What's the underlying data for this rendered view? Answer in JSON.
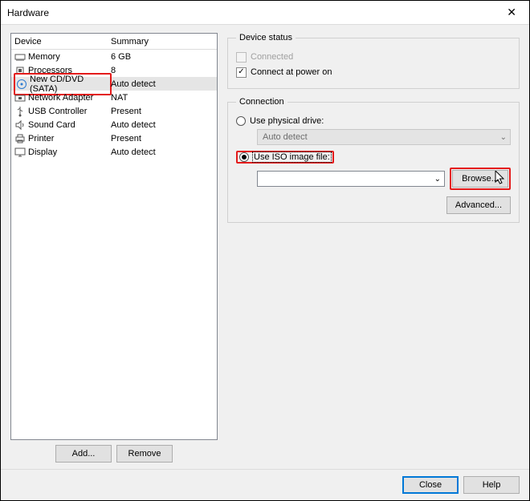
{
  "window": {
    "title": "Hardware"
  },
  "deviceList": {
    "headers": {
      "device": "Device",
      "summary": "Summary"
    },
    "items": [
      {
        "icon": "memory",
        "name": "Memory",
        "summary": "6 GB",
        "selected": false
      },
      {
        "icon": "cpu",
        "name": "Processors",
        "summary": "8",
        "selected": false
      },
      {
        "icon": "disc",
        "name": "New CD/DVD (SATA)",
        "summary": "Auto detect",
        "selected": true,
        "highlight": true
      },
      {
        "icon": "nic",
        "name": "Network Adapter",
        "summary": "NAT",
        "selected": false
      },
      {
        "icon": "usb",
        "name": "USB Controller",
        "summary": "Present",
        "selected": false
      },
      {
        "icon": "sound",
        "name": "Sound Card",
        "summary": "Auto detect",
        "selected": false
      },
      {
        "icon": "printer",
        "name": "Printer",
        "summary": "Present",
        "selected": false
      },
      {
        "icon": "display",
        "name": "Display",
        "summary": "Auto detect",
        "selected": false
      }
    ]
  },
  "leftButtons": {
    "add": "Add...",
    "remove": "Remove"
  },
  "deviceStatus": {
    "legend": "Device status",
    "connected": {
      "label": "Connected",
      "checked": false,
      "enabled": false
    },
    "connectAtPowerOn": {
      "label": "Connect at power on",
      "checked": true,
      "enabled": true
    }
  },
  "connection": {
    "legend": "Connection",
    "physical": {
      "label": "Use physical drive:",
      "selected": false,
      "combo": "Auto detect"
    },
    "iso": {
      "label": "Use ISO image file:",
      "selected": true,
      "path": "",
      "browse": "Browse...",
      "highlight": true
    },
    "advanced": "Advanced..."
  },
  "footer": {
    "close": "Close",
    "help": "Help"
  }
}
